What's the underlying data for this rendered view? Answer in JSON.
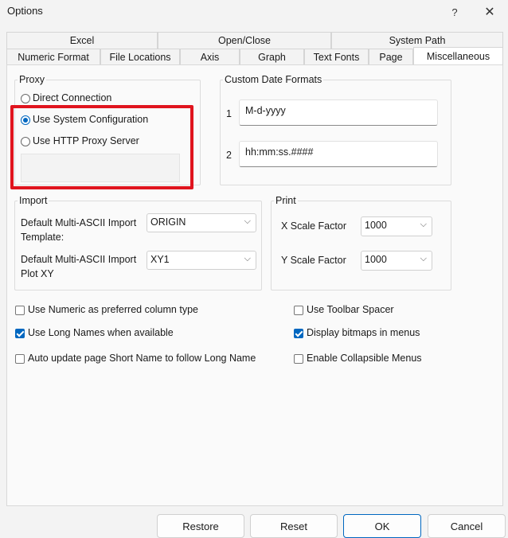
{
  "window": {
    "title": "Options",
    "help_label": "?",
    "close_label": "✕"
  },
  "tabs_back": [
    "Excel",
    "Open/Close",
    "System Path"
  ],
  "tabs_front": [
    "Numeric Format",
    "File Locations",
    "Axis",
    "Graph",
    "Text Fonts",
    "Page",
    "Miscellaneous"
  ],
  "active_tab": "Miscellaneous",
  "proxy": {
    "label": "Proxy",
    "options": [
      "Direct Connection",
      "Use System Configuration",
      "Use HTTP Proxy Server"
    ],
    "selected": "Use System Configuration"
  },
  "date_formats": {
    "label": "Custom Date Formats",
    "rows": [
      {
        "index": "1",
        "value": "M-d-yyyy"
      },
      {
        "index": "2",
        "value": "hh:mm:ss.####"
      }
    ]
  },
  "import": {
    "label": "Import",
    "template_label": "Default Multi-ASCII Import Template:",
    "template_value": "ORIGIN",
    "plotxy_label": "Default Multi-ASCII Import Plot XY",
    "plotxy_value": "XY1"
  },
  "print": {
    "label": "Print",
    "x_label": "X Scale Factor",
    "x_value": "1000",
    "y_label": "Y Scale Factor",
    "y_value": "1000"
  },
  "checkboxes_left": [
    {
      "label": "Use Numeric as preferred column type",
      "checked": false
    },
    {
      "label": "Use Long Names when available",
      "checked": true
    },
    {
      "label": "Auto update page Short Name to follow Long Name",
      "checked": false
    }
  ],
  "checkboxes_right": [
    {
      "label": "Use Toolbar Spacer",
      "checked": false
    },
    {
      "label": "Display bitmaps in menus",
      "checked": true
    },
    {
      "label": "Enable Collapsible Menus",
      "checked": false
    }
  ],
  "buttons": {
    "restore": "Restore",
    "reset": "Reset",
    "ok": "OK",
    "cancel": "Cancel"
  },
  "colors": {
    "accent": "#0067c0",
    "highlight": "#e0141e"
  }
}
